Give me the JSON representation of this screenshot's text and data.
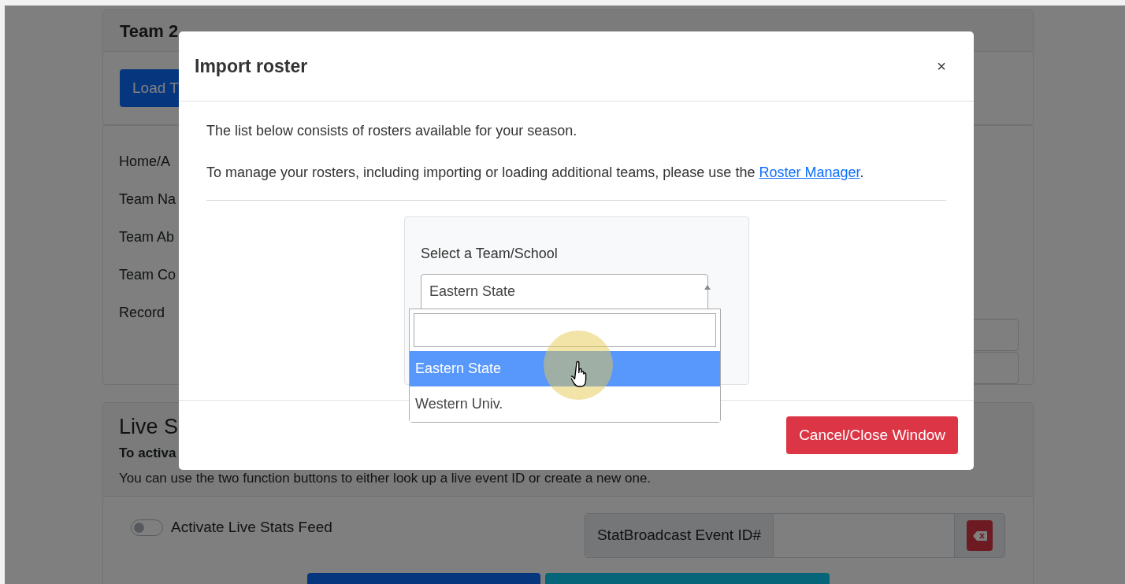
{
  "background_page": {
    "team_card": {
      "title": "Team 2",
      "load_button": "Load T"
    },
    "fields": [
      "Home/A",
      "Team Na",
      "Team Ab",
      "Team Co",
      "Record"
    ],
    "live_card": {
      "title": "Live S",
      "bold_note": "To activa",
      "note": "You can use the two function buttons to either look up a live event ID or create a new one.",
      "toggle": {
        "label": "Activate Live Stats Feed",
        "on": false
      },
      "event_id": {
        "addon": "StatBroadcast Event ID#"
      }
    }
  },
  "modal": {
    "title": "Import roster",
    "close": "×",
    "intro": "The list below consists of rosters available for your season.",
    "manage_text": "To manage your rosters, including importing or loading additional teams, please use the ",
    "link": "Roster Manager",
    "manage_suffix": ".",
    "select": {
      "label": "Select a Team/School",
      "value": "Eastern State",
      "expanded": true,
      "options": [
        {
          "label": "Eastern State",
          "selected": true
        },
        {
          "label": "Western Univ.",
          "selected": false
        }
      ]
    },
    "footer_button": "Cancel/Close Window"
  }
}
